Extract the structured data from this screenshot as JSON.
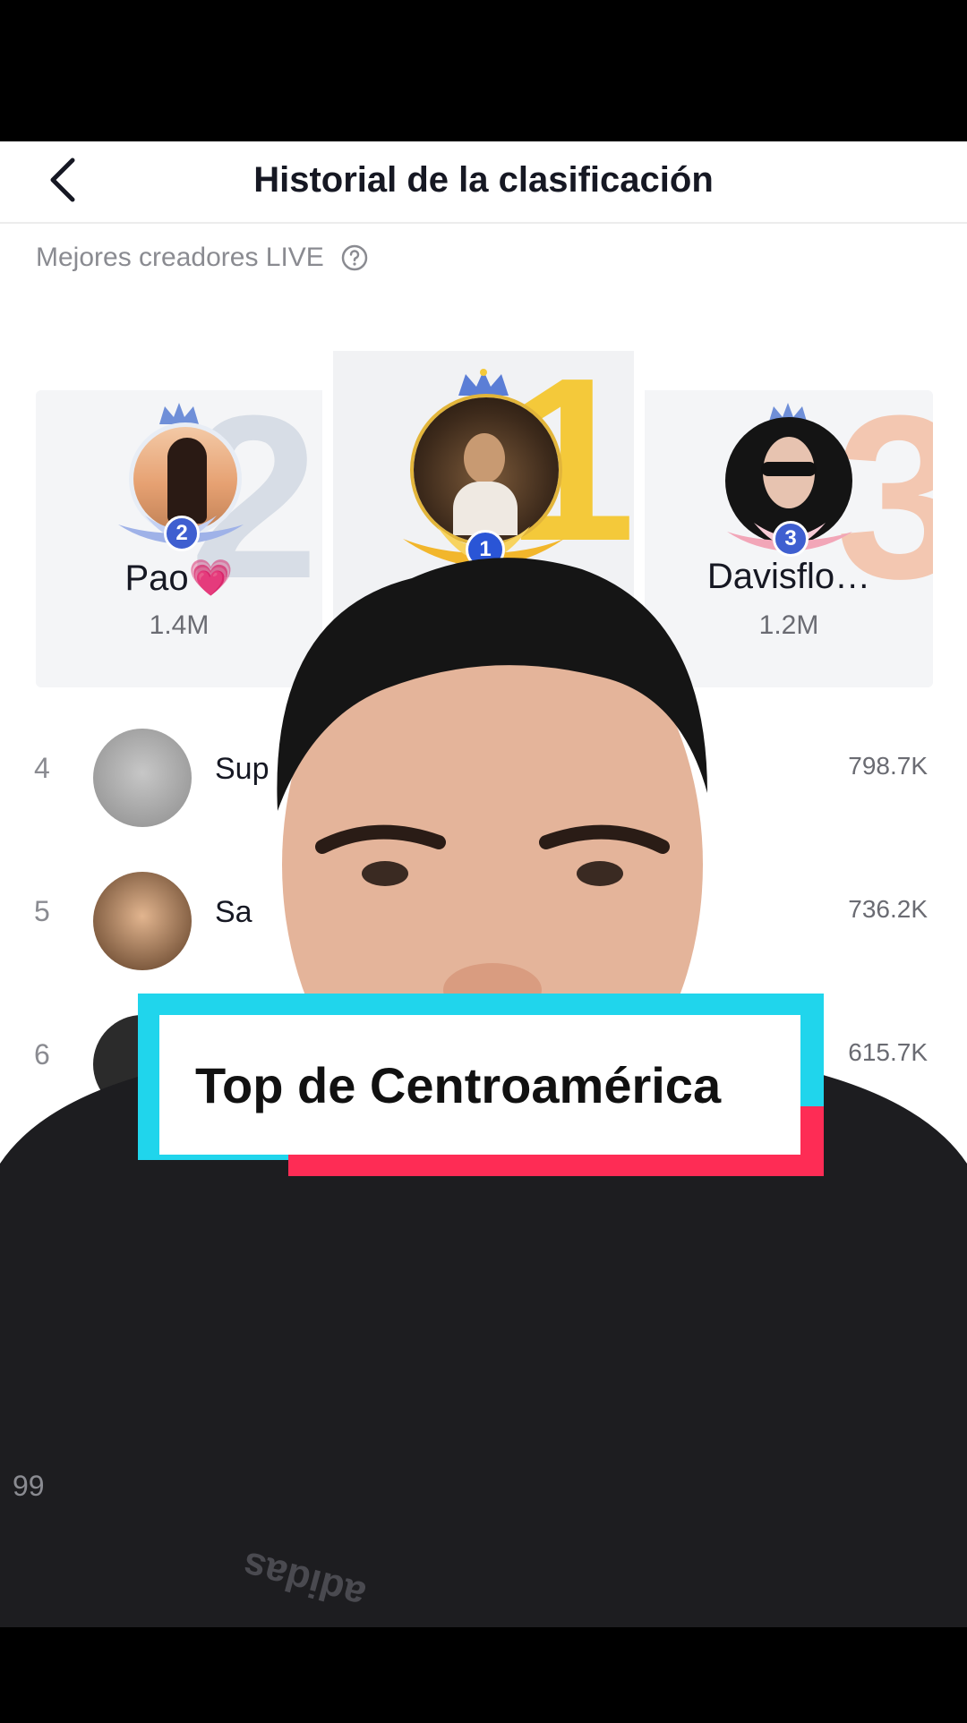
{
  "header": {
    "title": "Historial de la clasificación",
    "back_icon": "chevron-left-icon"
  },
  "section": {
    "label": "Mejores creadores LIVE",
    "help_icon": "question-circle-icon"
  },
  "podium": [
    {
      "rank": "1",
      "name": "",
      "score": "",
      "badge_color": "#2a55d6"
    },
    {
      "rank": "2",
      "name": "Pao💗",
      "score": "1.4M",
      "badge_color": "#3f5fd0"
    },
    {
      "rank": "3",
      "name": "Davisflo…",
      "score": "1.2M",
      "badge_color": "#3f5fd0"
    }
  ],
  "rows": [
    {
      "rank": "4",
      "name": "Sup",
      "score": "798.7K"
    },
    {
      "rank": "5",
      "name": "Sa",
      "score": "736.2K"
    },
    {
      "rank": "6",
      "name": "",
      "score": "615.7K"
    }
  ],
  "partial_rank": "99",
  "caption": {
    "text": "Top de Centroamérica"
  },
  "shirt_brand": "adidas",
  "colors": {
    "cyan": "#20d5ec",
    "red": "#fe2c55",
    "rank_gold": "#f4c93a",
    "rank_silver": "#d5dce6",
    "rank_bronze": "#f3c7b1"
  }
}
